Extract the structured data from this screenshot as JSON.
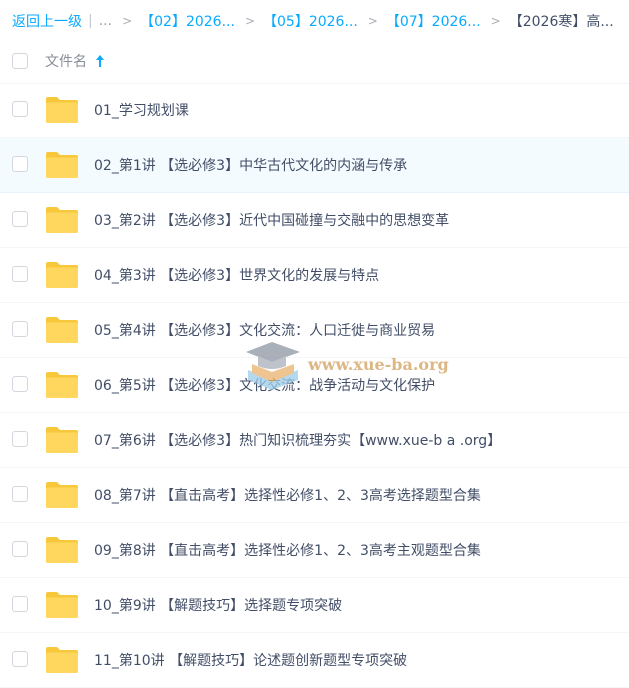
{
  "breadcrumb": {
    "back_label": "返回上一级",
    "separator": "|",
    "ellipsis": "...",
    "arrow": ">",
    "links": [
      "【02】2026...",
      "【05】2026...",
      "【07】2026..."
    ],
    "current": "【2026寒】高..."
  },
  "header": {
    "column_label": "文件名"
  },
  "files": [
    {
      "name": "01_学习规划课",
      "icon": "folder-icon"
    },
    {
      "name": "02_第1讲 【选必修3】中华古代文化的内涵与传承",
      "icon": "folder-icon"
    },
    {
      "name": "03_第2讲 【选必修3】近代中国碰撞与交融中的思想变革",
      "icon": "folder-icon"
    },
    {
      "name": "04_第3讲 【选必修3】世界文化的发展与特点",
      "icon": "folder-icon"
    },
    {
      "name": "05_第4讲 【选必修3】文化交流：人口迁徙与商业贸易",
      "icon": "folder-icon"
    },
    {
      "name": "06_第5讲 【选必修3】文化交流：战争活动与文化保护",
      "icon": "folder-icon"
    },
    {
      "name": "07_第6讲 【选必修3】热门知识梳理夯实【www.xue-b a .org】",
      "icon": "folder-icon"
    },
    {
      "name": "08_第7讲 【直击高考】选择性必修1、2、3高考选择题型合集",
      "icon": "folder-icon"
    },
    {
      "name": "09_第8讲 【直击高考】选择性必修1、2、3高考主观题型合集",
      "icon": "folder-icon"
    },
    {
      "name": "10_第9讲 【解题技巧】选择题专项突破",
      "icon": "folder-icon"
    },
    {
      "name": "11_第10讲 【解题技巧】论述题创新题型专项突破",
      "icon": "folder-icon"
    }
  ],
  "hovered_row": 1,
  "watermark": {
    "text": "www.xue-ba.org"
  },
  "colors": {
    "link": "#09aaff",
    "folder": "#ffd75e",
    "text": "#424e67",
    "hover_bg": "#f4fbff"
  }
}
